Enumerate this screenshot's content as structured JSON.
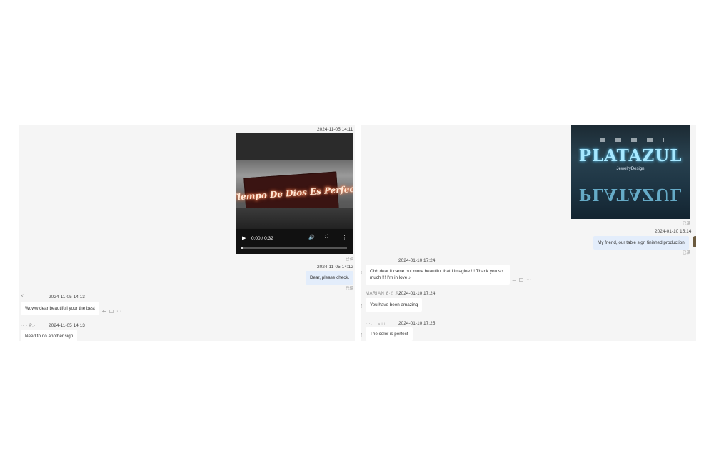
{
  "left": {
    "messages": [
      {
        "timestamp": "2024-11-05 14:11"
      },
      {
        "video": {
          "time": "0:00 / 0:32",
          "sign_text": "El Tiempo De Dios Es Perfecto",
          "progress": 0.0
        }
      },
      {
        "timestamp": "2024-11-05 14:12",
        "text": "Dear, please check."
      },
      {
        "sender": "K.. . .",
        "timestamp": "2024-11-05 14:13",
        "text": "Woww dear beautifull your the best"
      },
      {
        "sender": "·· · ₽.·.",
        "timestamp": "2024-11-05 14:13",
        "text": "Need to do another sign"
      }
    ],
    "status_mark": "已读"
  },
  "right": {
    "photo": {
      "brand": "PLATAZUL",
      "sub": "JewelryDesign"
    },
    "messages": [
      {
        "timestamp": "2024-01-10 15:14",
        "text": "My friend, our table sign finished production"
      },
      {
        "timestamp": "2024-01-10 17:24",
        "text": "Ohh dear it came out more beautiful that I imagine !!! Thank you so much !!! I'm in love ♪"
      },
      {
        "sender": "MARIAN ℇ·ℰ ℛℰ",
        "timestamp": "2024-01-10 17:24",
        "text": "You have been amazing"
      },
      {
        "sender": "·.·.· ₗ ₐ ₗ ₗ",
        "timestamp": "2024-01-10 17:25",
        "text": "The color is perfect"
      }
    ],
    "status_mark": "已读"
  },
  "icons": {
    "reply": "⇐",
    "quote": "☐",
    "more": "···",
    "play": "▶",
    "volume": "🔊",
    "fullscreen": "⛶",
    "menu": "⋮",
    "dots": "⋮"
  }
}
